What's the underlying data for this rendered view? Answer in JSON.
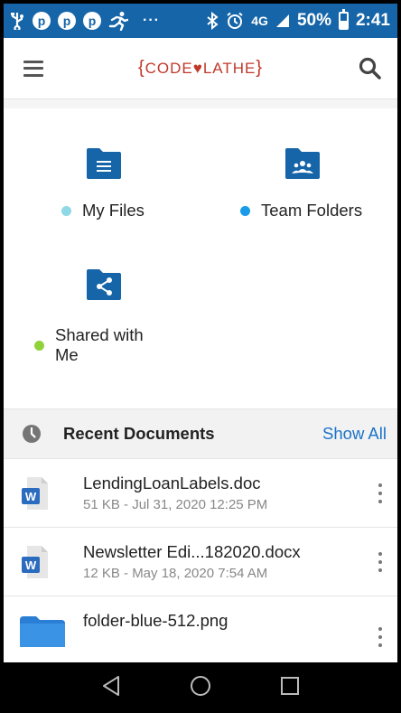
{
  "status_bar": {
    "battery": "50%",
    "time": "2:41",
    "network": "4G",
    "overflow": "···"
  },
  "app_bar": {
    "logo_text": "CODE♥LATHE",
    "logo_open_brace": "{",
    "logo_close_brace": "}"
  },
  "folders": [
    {
      "label": "My Files",
      "dot_color": "#8fd8e6",
      "icon": "folder-document-icon"
    },
    {
      "label": "Team Folders",
      "dot_color": "#1a9be8",
      "icon": "folder-team-icon"
    },
    {
      "label_line1": "Shared with",
      "label_line2": "Me",
      "dot_color": "#8fd23a",
      "icon": "folder-share-icon"
    }
  ],
  "recent": {
    "title": "Recent Documents",
    "show_all": "Show All"
  },
  "documents": [
    {
      "name": "LendingLoanLabels.doc",
      "meta": "51 KB - Jul 31, 2020 12:25 PM",
      "icon": "word-doc-icon"
    },
    {
      "name": "Newsletter Edi...182020.docx",
      "meta": "12 KB - May 18, 2020 7:54 AM",
      "icon": "word-doc-icon"
    },
    {
      "name": "folder-blue-512.png",
      "meta": "",
      "icon": "image-folder-icon"
    }
  ],
  "colors": {
    "status_bar": "#1565a8",
    "folder_blue": "#1565a8",
    "accent_link": "#1a73c8",
    "logo_red": "#c0392b"
  }
}
